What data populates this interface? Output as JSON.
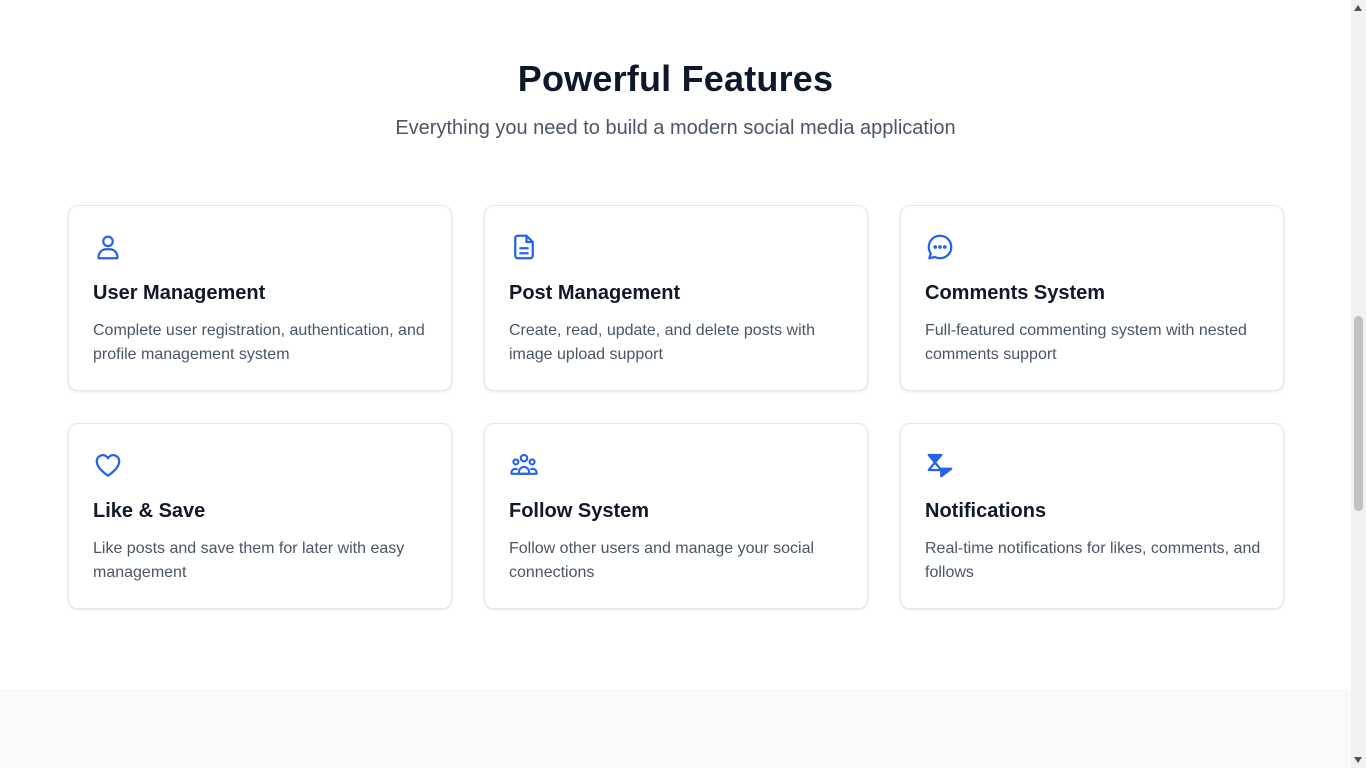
{
  "features_section": {
    "title": "Powerful Features",
    "subtitle": "Everything you need to build a modern social media application",
    "icon_color": "#2563eb",
    "cards": [
      {
        "icon": "user-icon",
        "title": "User Management",
        "description": "Complete user registration, authentication, and profile management system"
      },
      {
        "icon": "document-icon",
        "title": "Post Management",
        "description": "Create, read, update, and delete posts with image upload support"
      },
      {
        "icon": "chat-bubble-icon",
        "title": "Comments System",
        "description": "Full-featured commenting system with nested comments support"
      },
      {
        "icon": "heart-icon",
        "title": "Like & Save",
        "description": "Like posts and save them for later with easy management"
      },
      {
        "icon": "users-group-icon",
        "title": "Follow System",
        "description": "Follow other users and manage your social connections"
      },
      {
        "icon": "notification-icon",
        "title": "Notifications",
        "description": "Real-time notifications for likes, comments, and follows"
      }
    ]
  }
}
